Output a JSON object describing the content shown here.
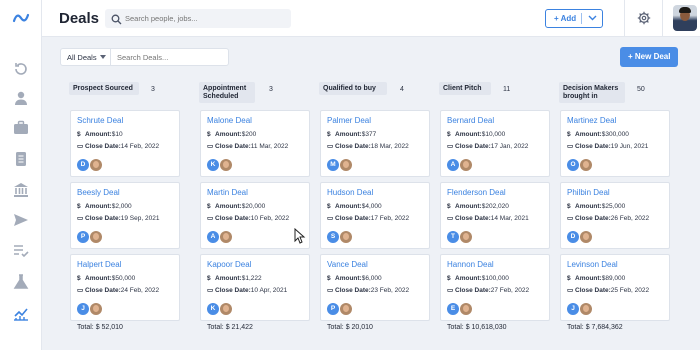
{
  "header": {
    "title": "Deals",
    "search_placeholder": "Search people, jobs...",
    "add_label": "+ Add"
  },
  "toolbar": {
    "filter_value": "All Deals",
    "filter_search_placeholder": "Search Deals...",
    "new_deal_label": "+ New Deal"
  },
  "labels": {
    "amount": "Amount:",
    "close_date": "Close Date:",
    "total": "Total: "
  },
  "colors": {
    "accent": "#3b82e0",
    "button": "#4a8de6"
  },
  "columns": [
    {
      "name": "Prospect Sourced",
      "count": "3",
      "total": "$ 52,010",
      "deals": [
        {
          "title": "Schrute Deal",
          "amount": "$10",
          "close_date": "14 Feb, 2022",
          "assignee": "D"
        },
        {
          "title": "Beesly Deal",
          "amount": "$2,000",
          "close_date": "19 Sep, 2021",
          "assignee": "P"
        },
        {
          "title": "Halpert Deal",
          "amount": "$50,000",
          "close_date": "24 Feb, 2022",
          "assignee": "J"
        }
      ]
    },
    {
      "name": "Appointment Scheduled",
      "count": "3",
      "total": "$ 21,422",
      "deals": [
        {
          "title": "Malone Deal",
          "amount": "$200",
          "close_date": "11 Mar, 2022",
          "assignee": "K"
        },
        {
          "title": "Martin Deal",
          "amount": "$20,000",
          "close_date": "10 Feb, 2022",
          "assignee": "A"
        },
        {
          "title": "Kapoor Deal",
          "amount": "$1,222",
          "close_date": "10 Apr, 2021",
          "assignee": "K"
        }
      ]
    },
    {
      "name": "Qualified to buy",
      "count": "4",
      "total": "$ 20,010",
      "deals": [
        {
          "title": "Palmer Deal",
          "amount": "$377",
          "close_date": "18 Mar, 2022",
          "assignee": "M"
        },
        {
          "title": "Hudson Deal",
          "amount": "$4,000",
          "close_date": "17 Feb, 2022",
          "assignee": "S"
        },
        {
          "title": "Vance Deal",
          "amount": "$6,000",
          "close_date": "23 Feb, 2022",
          "assignee": "P"
        }
      ]
    },
    {
      "name": "Client Pitch",
      "count": "11",
      "total": "$ 10,618,030",
      "deals": [
        {
          "title": "Bernard Deal",
          "amount": "$10,000",
          "close_date": "17 Jan, 2022",
          "assignee": "A"
        },
        {
          "title": "Flenderson Deal",
          "amount": "$202,020",
          "close_date": "14 Mar, 2021",
          "assignee": "T"
        },
        {
          "title": "Hannon Deal",
          "amount": "$100,000",
          "close_date": "27 Feb, 2022",
          "assignee": "E"
        }
      ]
    },
    {
      "name": "Decision Makers brought in",
      "count": "50",
      "total": "$ 7,684,362",
      "deals": [
        {
          "title": "Martinez Deal",
          "amount": "$300,000",
          "close_date": "19 Jun, 2021",
          "assignee": "O"
        },
        {
          "title": "Philbin Deal",
          "amount": "$25,000",
          "close_date": "26 Feb, 2022",
          "assignee": "D"
        },
        {
          "title": "Levinson Deal",
          "amount": "$89,000",
          "close_date": "25 Feb, 2022",
          "assignee": "J"
        }
      ]
    }
  ]
}
